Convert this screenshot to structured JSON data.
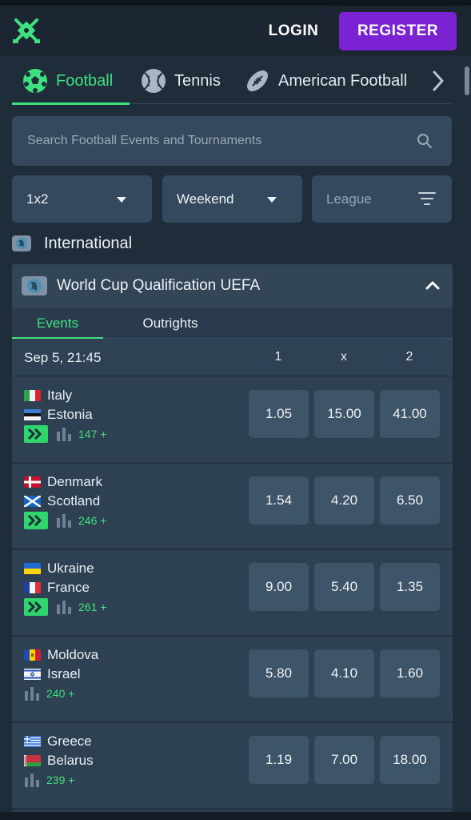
{
  "header": {
    "login_label": "LOGIN",
    "register_label": "REGISTER",
    "logo_icon": "crossed-swords-logo-icon",
    "accent_color": "#3ee07f",
    "register_color": "#7b22d3"
  },
  "sports_tabs": [
    {
      "label": "Football",
      "icon": "football-icon",
      "active": true
    },
    {
      "label": "Tennis",
      "icon": "tennis-ball-icon",
      "active": false
    },
    {
      "label": "American Football",
      "icon": "american-football-icon",
      "active": false
    }
  ],
  "search": {
    "placeholder": "Search Football Events and Tournaments"
  },
  "filters": {
    "market": "1x2",
    "period": "Weekend",
    "league_placeholder": "League"
  },
  "section": {
    "title": "International"
  },
  "competition": {
    "title": "World Cup Qualification UEFA",
    "subtabs": [
      "Events",
      "Outrights"
    ],
    "date": "Sep 5, 21:45",
    "columns": [
      "1",
      "x",
      "2"
    ]
  },
  "events": [
    {
      "home": "Italy",
      "away": "Estonia",
      "live": true,
      "markets": "147 +",
      "odds": [
        "1.05",
        "15.00",
        "41.00"
      ]
    },
    {
      "home": "Denmark",
      "away": "Scotland",
      "live": true,
      "markets": "246 +",
      "odds": [
        "1.54",
        "4.20",
        "6.50"
      ]
    },
    {
      "home": "Ukraine",
      "away": "France",
      "live": true,
      "markets": "261 +",
      "odds": [
        "9.00",
        "5.40",
        "1.35"
      ]
    },
    {
      "home": "Moldova",
      "away": "Israel",
      "live": false,
      "markets": "240 +",
      "odds": [
        "5.80",
        "4.10",
        "1.60"
      ]
    },
    {
      "home": "Greece",
      "away": "Belarus",
      "live": false,
      "markets": "239 +",
      "odds": [
        "1.19",
        "7.00",
        "18.00"
      ]
    }
  ]
}
